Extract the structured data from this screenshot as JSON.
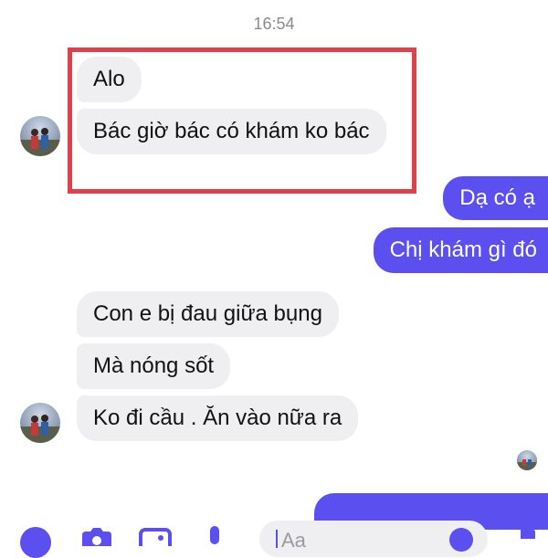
{
  "conversation": {
    "timestamp": "16:54",
    "messages": [
      {
        "side": "incoming",
        "text": "Alo"
      },
      {
        "side": "incoming",
        "text": "Bác giờ bác có khám ko bác"
      },
      {
        "side": "outgoing",
        "text": "Dạ có ạ"
      },
      {
        "side": "outgoing",
        "text": "Chị khám gì đó"
      },
      {
        "side": "incoming",
        "text": "Con e bị đau giữa bụng"
      },
      {
        "side": "incoming",
        "text": "Mà nóng sốt"
      },
      {
        "side": "incoming",
        "text": "Ko đi cầu . Ăn vào nữa ra"
      }
    ]
  },
  "composer": {
    "input_text": "Aa",
    "icons": [
      "plus-icon",
      "camera-icon",
      "image-icon",
      "microphone-icon",
      "emoji-icon",
      "like-icon"
    ]
  },
  "colors": {
    "outgoing_bubble": "#5b4ff0",
    "incoming_bubble": "#efeff1",
    "highlight_border": "#e0404a",
    "timestamp_text": "#8a8a8e"
  }
}
